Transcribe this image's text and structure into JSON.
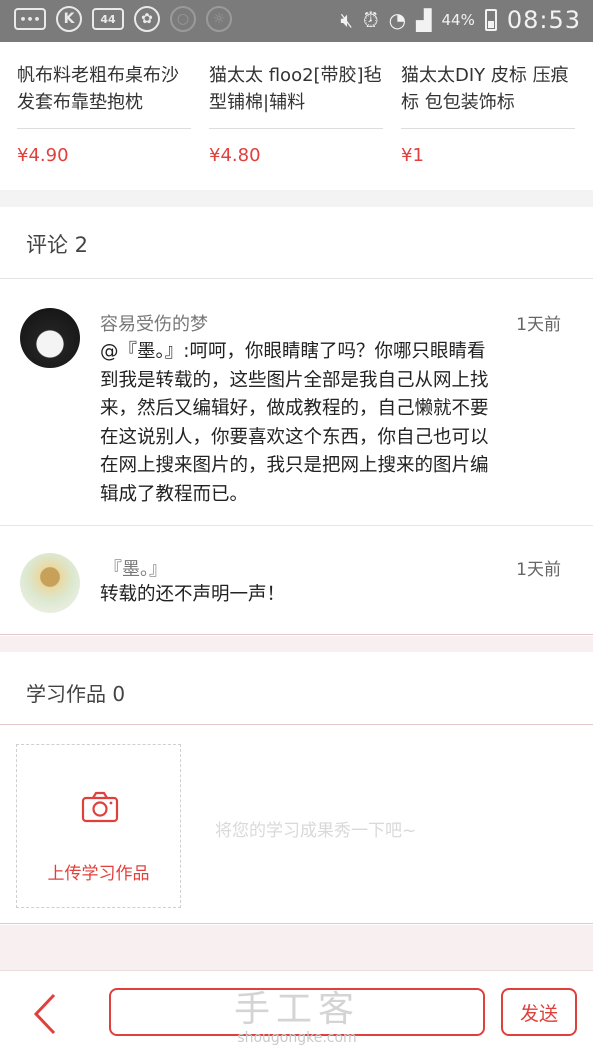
{
  "status_bar": {
    "battery": "44%",
    "time": "08:53",
    "icons": [
      "chat-bubble-icon",
      "k-app-icon",
      "44-badge-icon",
      "squirrel-icon",
      "search-icon",
      "brightness-icon",
      "mute-icon",
      "alarm-icon",
      "wifi-icon",
      "signal-icon",
      "battery-icon"
    ],
    "badge_text": "44",
    "k_text": "K"
  },
  "products": [
    {
      "title": "帆布料老粗布桌布沙发套布靠垫抱枕",
      "price": "¥4.90"
    },
    {
      "title": "猫太太 floo2[带胶]毡型铺棉|辅料",
      "price": "¥4.80"
    },
    {
      "title": "猫太太DIY 皮标 压痕标 包包装饰标",
      "price": "¥1"
    }
  ],
  "comments_section": {
    "title": "评论 2",
    "comments": [
      {
        "name": "容易受伤的梦",
        "time": "1天前",
        "text": "@『墨。』:呵呵，你眼睛瞎了吗？你哪只眼睛看到我是转载的，这些图片全部是我自己从网上找来，然后又编辑好，做成教程的，自己懒就不要在这说别人，你要喜欢这个东西，你自己也可以在网上搜来图片的，我只是把网上搜来的图片编辑成了教程而已。"
      },
      {
        "name": "『墨。』",
        "time": "1天前",
        "text": "转载的还不声明一声！"
      }
    ]
  },
  "works_section": {
    "title": "学习作品 0",
    "upload_label": "上传学习作品",
    "hint": "将您的学习成果秀一下吧~"
  },
  "bottom_bar": {
    "input_value": "",
    "send_label": "发送",
    "watermark_main": "手工客",
    "watermark_sub": "shougongke.com"
  },
  "colors": {
    "accent": "#e0403c",
    "status_bar": "#7b7b7b",
    "divider": "#f3f3f3"
  }
}
